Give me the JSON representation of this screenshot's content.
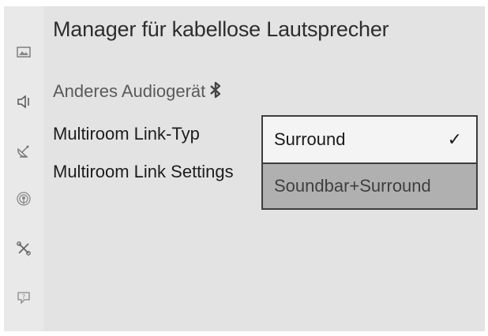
{
  "window": {
    "title": "Manager für kabellose Lautsprecher"
  },
  "sidebar": {
    "items": [
      {
        "icon": "picture-icon"
      },
      {
        "icon": "speaker-icon"
      },
      {
        "icon": "satellite-dish-icon"
      },
      {
        "icon": "broadcast-icon"
      },
      {
        "icon": "tools-icon"
      },
      {
        "icon": "support-icon"
      }
    ]
  },
  "menu": {
    "items": [
      {
        "label": "Anderes Audiogerät",
        "icon": "bluetooth-icon"
      },
      {
        "label": "Multiroom Link-Typ"
      },
      {
        "label": "Multiroom Link Settings"
      }
    ]
  },
  "dropdown": {
    "options": [
      {
        "label": "Surround",
        "check": "✓"
      },
      {
        "label": "Soundbar+Surround"
      }
    ]
  },
  "colors": {
    "background": "#e3e3e3",
    "dropdown_selected": "#f4f4f4",
    "dropdown_other": "#b0b0b0",
    "border": "#3d3d3d"
  }
}
